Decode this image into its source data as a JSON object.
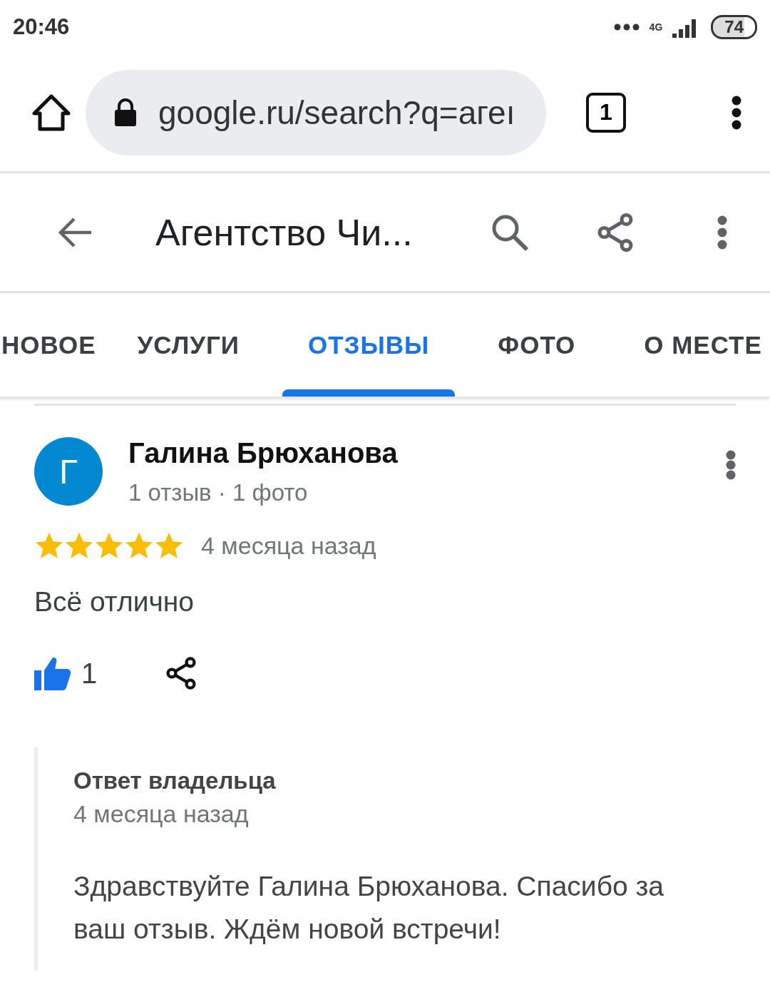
{
  "status_bar": {
    "time": "20:46",
    "network": "4G",
    "battery": "74"
  },
  "browser": {
    "url": "google.ru/search?q=aгеı",
    "tab_count": "1"
  },
  "toolbar": {
    "title": "Агентство Чи..."
  },
  "tabs": [
    {
      "label": "НОВОЕ",
      "selected": false
    },
    {
      "label": "УСЛУГИ",
      "selected": false
    },
    {
      "label": "ОТЗЫВЫ",
      "selected": true
    },
    {
      "label": "ФОТО",
      "selected": false
    },
    {
      "label": "О МЕСТЕ",
      "selected": false
    }
  ],
  "review": {
    "avatar_letter": "Г",
    "author": "Галина Брюханова",
    "meta": "1 отзыв · 1 фото",
    "stars": 5,
    "time": "4 месяца назад",
    "text": "Всё отлично",
    "likes": "1",
    "liked": true,
    "owner_reply": {
      "title": "Ответ владельца",
      "time": "4 месяца назад",
      "text": "Здравствуйте Галина Брюханова. Спасибо за ваш отзыв. Ждём новой встречи!"
    }
  }
}
